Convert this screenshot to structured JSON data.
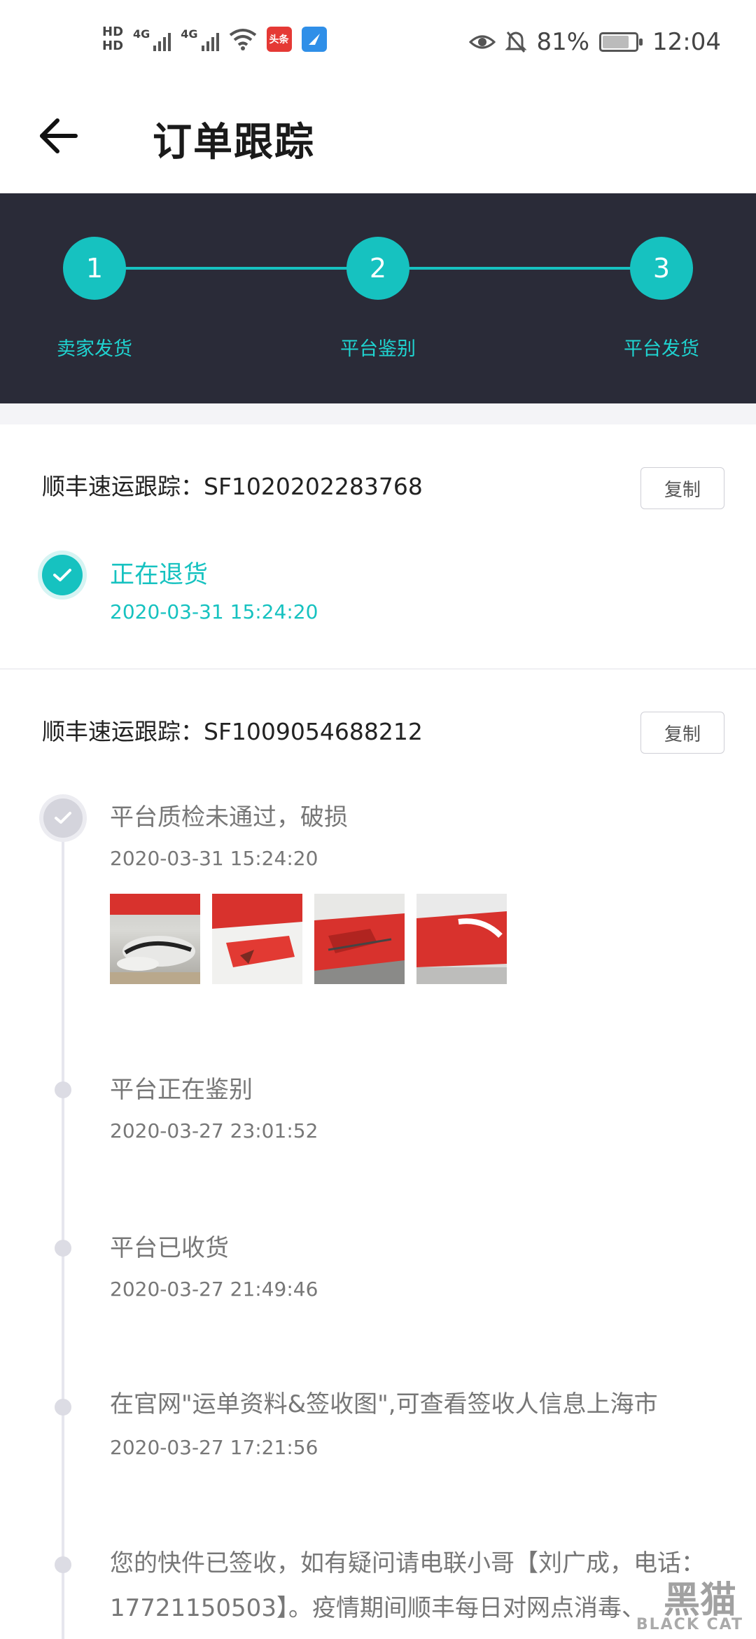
{
  "status_bar": {
    "hd1": "HD",
    "hd2": "HD",
    "net1": "4G",
    "net2": "4G",
    "app_badge": "头条",
    "battery_percent": "81%",
    "battery_level": 0.81,
    "time": "12:04",
    "icons": [
      "eye-icon",
      "bell-off-icon",
      "wifi-icon",
      "battery-icon"
    ]
  },
  "header": {
    "title": "订单跟踪"
  },
  "steps": [
    {
      "number": "1",
      "label": "卖家发货"
    },
    {
      "number": "2",
      "label": "平台鉴别"
    },
    {
      "number": "3",
      "label": "平台发货"
    }
  ],
  "tracking1": {
    "label": "顺丰速运跟踪：SF1020202283768",
    "copy": "复制",
    "event": {
      "title": "正在退货",
      "time": "2020-03-31 15:24:20"
    }
  },
  "tracking2": {
    "label": "顺丰速运跟踪：SF1009054688212",
    "copy": "复制",
    "events": [
      {
        "title": "平台质检未通过，破损",
        "time": "2020-03-31 15:24:20"
      },
      {
        "title": "平台正在鉴别",
        "time": "2020-03-27 23:01:52"
      },
      {
        "title": "平台已收货",
        "time": "2020-03-27 21:49:46"
      },
      {
        "title": "在官网\"运单资料&签收图\",可查看签收人信息上海市",
        "time": "2020-03-27 17:21:56"
      },
      {
        "title": "您的快件已签收，如有疑问请电联小哥【刘广成，电话：17721150503】。疫情期间顺丰每日对网点消毒、"
      }
    ]
  },
  "watermark": {
    "cn": "黑猫",
    "en": "BLACK CAT"
  },
  "colors": {
    "accent": "#16c2c0",
    "stepper_bg": "#2a2b38"
  }
}
